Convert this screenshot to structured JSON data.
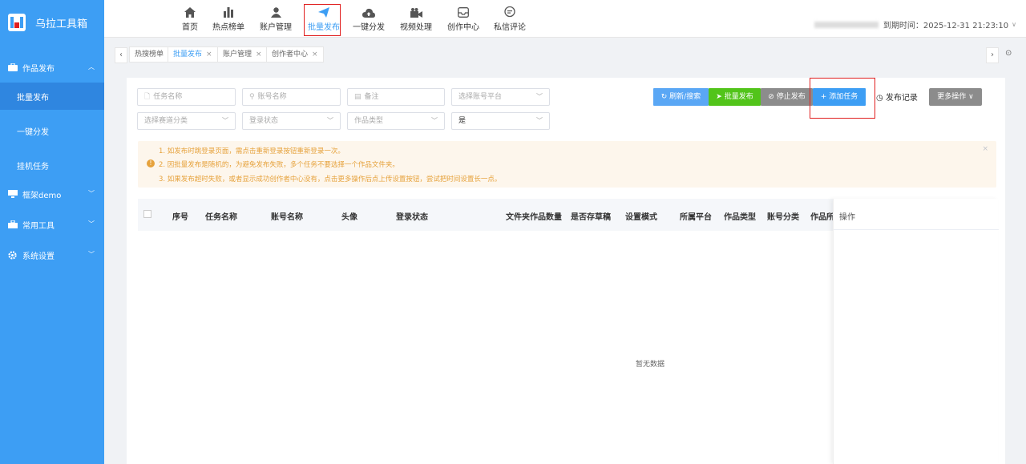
{
  "app": {
    "title": "乌拉工具箱"
  },
  "sidebar": {
    "groups": [
      {
        "label": "作品发布",
        "icon": "briefcase-icon",
        "expanded": true,
        "items": [
          {
            "label": "批量发布",
            "active": true
          },
          {
            "label": "一键分发",
            "active": false
          },
          {
            "label": "挂机任务",
            "active": false
          }
        ]
      },
      {
        "label": "框架demo",
        "icon": "monitor-icon",
        "expanded": false
      },
      {
        "label": "常用工具",
        "icon": "toolbox-icon",
        "expanded": false
      },
      {
        "label": "系统设置",
        "icon": "gear-icon",
        "expanded": false
      }
    ]
  },
  "topnav": {
    "items": [
      {
        "label": "首页",
        "icon": "home-icon"
      },
      {
        "label": "热点榜单",
        "icon": "bar-chart-icon"
      },
      {
        "label": "账户管理",
        "icon": "user-icon"
      },
      {
        "label": "批量发布",
        "icon": "paper-plane-icon",
        "active": true
      },
      {
        "label": "一键分发",
        "icon": "cloud-upload-icon"
      },
      {
        "label": "视频处理",
        "icon": "video-camera-icon"
      },
      {
        "label": "创作中心",
        "icon": "inbox-icon"
      },
      {
        "label": "私信评论",
        "icon": "chat-icon"
      }
    ],
    "expire": "到期时间：2025-12-31 21:23:10"
  },
  "tabs": [
    {
      "label": "热搜榜单",
      "closable": false
    },
    {
      "label": "批量发布",
      "closable": true,
      "active": true
    },
    {
      "label": "账户管理",
      "closable": true
    },
    {
      "label": "创作者中心",
      "closable": true
    }
  ],
  "filters": {
    "task_name": "任务名称",
    "account_name": "账号名称",
    "remark": "备注",
    "platform": "选择账号平台",
    "track": "选择赛道分类",
    "login_status": "登录状态",
    "work_type": "作品类型",
    "yes_value": "是"
  },
  "actions": {
    "refresh": "刷新/搜索",
    "batch_publish": "批量发布",
    "stop": "停止发布",
    "add_task": "+ 添加任务",
    "records": "发布记录",
    "more": "更多操作"
  },
  "notice": [
    "1. 如发布时跳登录页面，需点击重新登录按钮重新登录一次。",
    "2. 因批量发布是随机的，为避免发布失败，多个任务不要选择一个作品文件夹。",
    "3. 如果发布超时失败，或者显示成功创作者中心没有，点击更多操作后点上传设置按钮，尝试把时间设置长一点。"
  ],
  "table": {
    "columns": [
      "序号",
      "任务名称",
      "账号名称",
      "头像",
      "登录状态",
      "文件夹作品数量",
      "是否存草稿",
      "设置模式",
      "所属平台",
      "作品类型",
      "账号分类",
      "作品所"
    ],
    "op_column": "操作",
    "empty_text": "暂无数据"
  },
  "colors": {
    "accent": "#3d9ef4",
    "success": "#52c41a",
    "gray": "#8c8c8c",
    "warning": "#e6a23c",
    "highlight": "#e02020"
  }
}
